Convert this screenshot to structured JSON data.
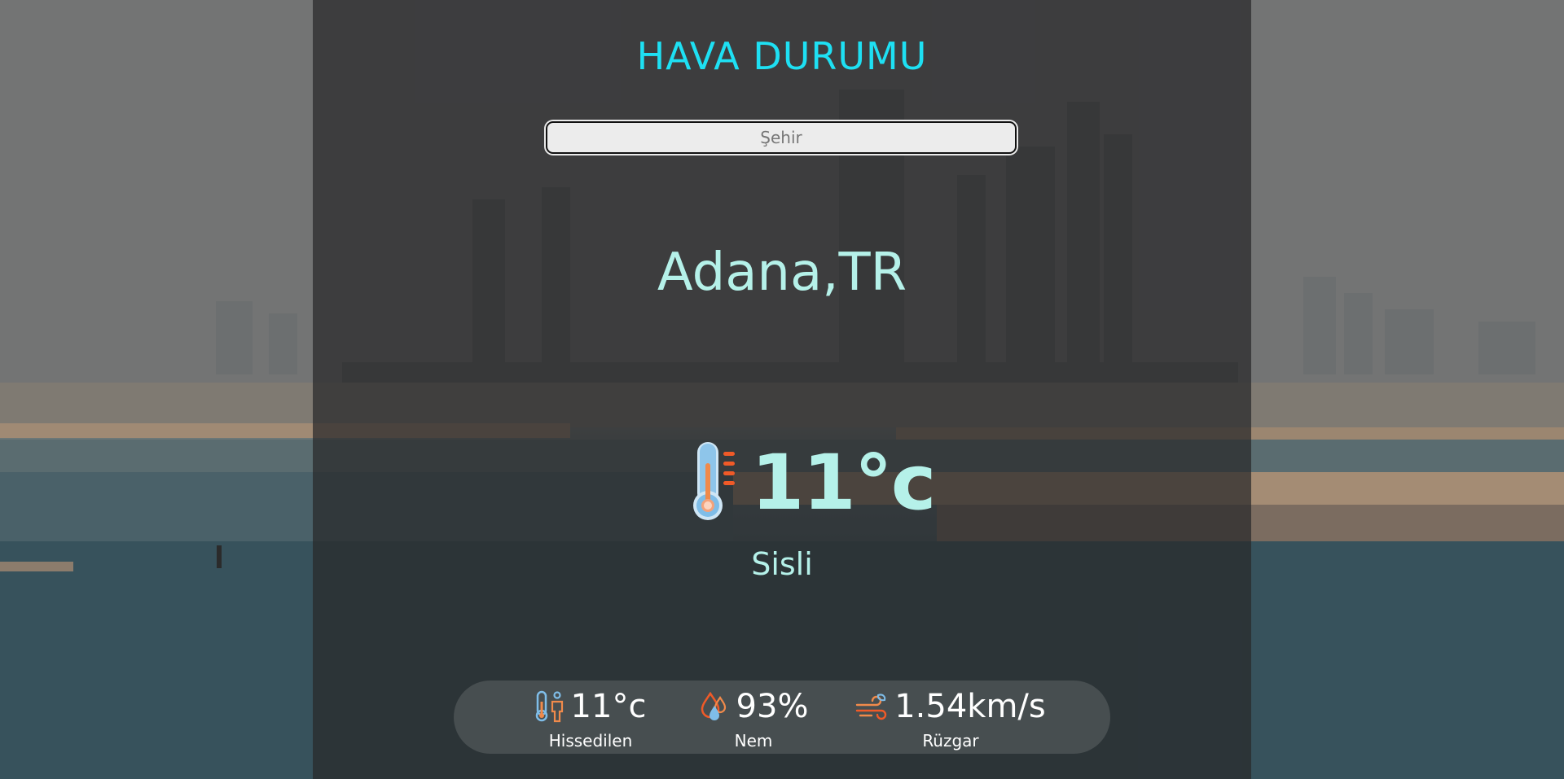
{
  "header": {
    "title": "HAVA DURUMU"
  },
  "search": {
    "placeholder": "Şehir",
    "value": ""
  },
  "location": {
    "city": "Adana,TR"
  },
  "current": {
    "temperature": "11°c",
    "condition": "Sisli",
    "icon": "thermometer-icon"
  },
  "details": [
    {
      "icon": "feels-like-icon",
      "value": "11°c",
      "label": "Hissedilen"
    },
    {
      "icon": "humidity-icon",
      "value": "93%",
      "label": "Nem"
    },
    {
      "icon": "wind-icon",
      "value": "1.54km/s",
      "label": "Rüzgar"
    }
  ],
  "colors": {
    "title": "#1ee0f3",
    "text_accent": "#b5f1e9",
    "panel": "#28282a"
  }
}
